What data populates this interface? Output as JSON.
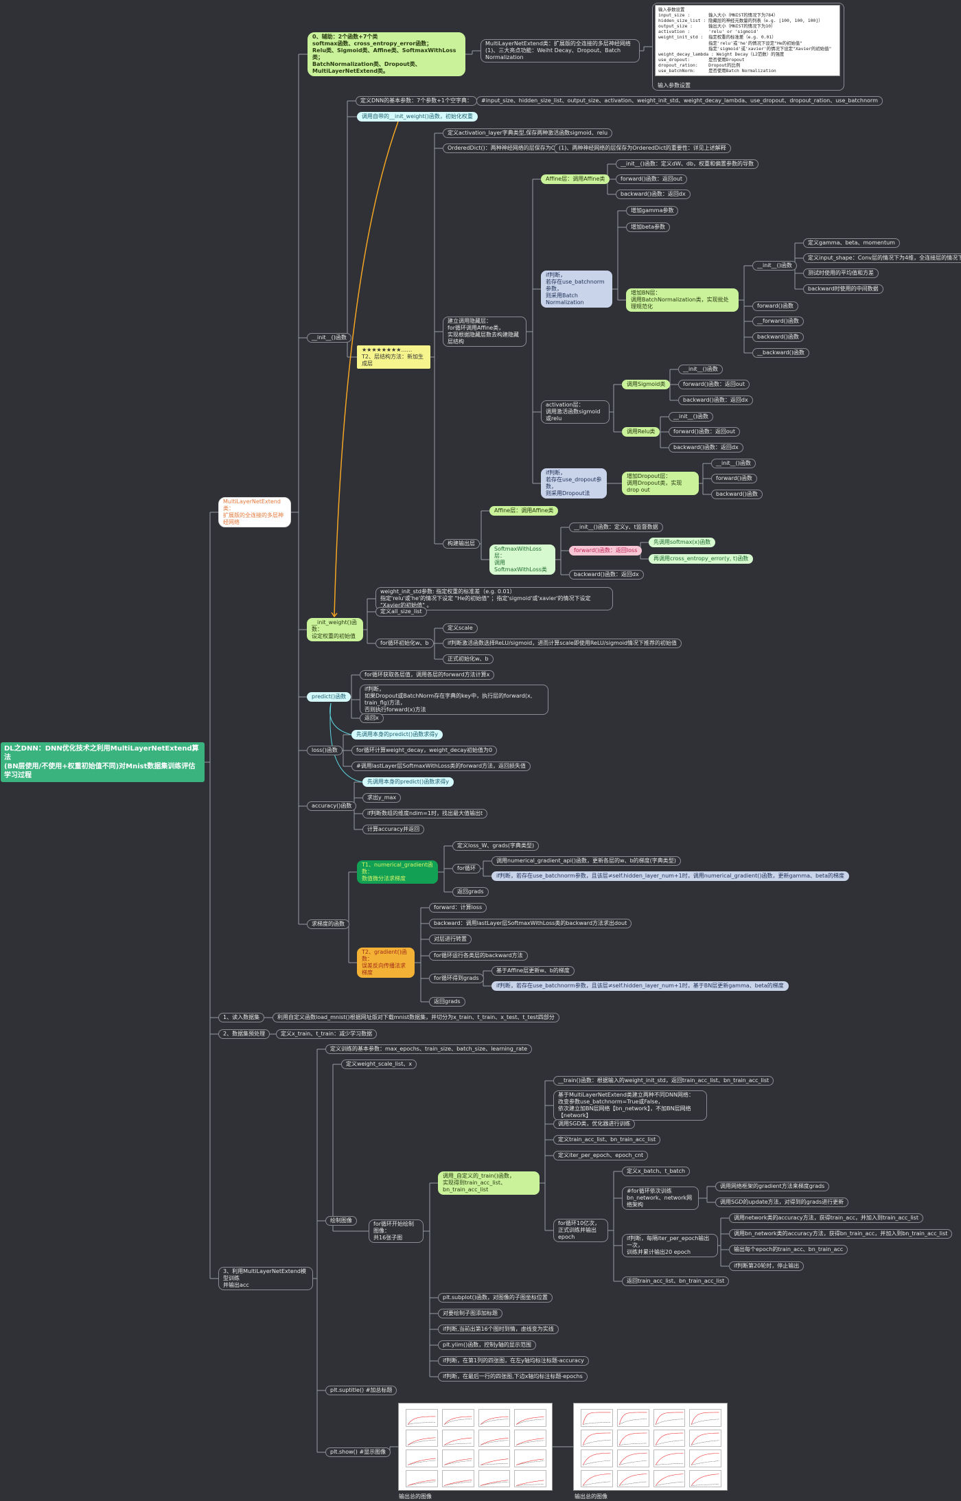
{
  "root": "DL之DNN：DNN优化技术之利用MultiLayerNetExtend算法\n(BN层使用/不使用+权重初始值不同)对Mnist数据集训练评估学习过程",
  "aux": {
    "label": "0、辅助：2个函数+7个类\nsoftmax函数、cross_entropy_error函数；\nRelu类、Sigmoid类、Affine类、SoftmaxWithLoss类；\nBatchNormalization类、Dropout类、MultiLayerNetExtend类。",
    "child": "MultiLayerNetExtend类：扩展版的全连接的多层神经网络\n(1)、三大亮点功能：Weiht Decay、Dropout、Batch Normalization",
    "params_caption": "输入参数设置",
    "params_lines": [
      "输入参数设置",
      "input_size :       输入大小（MNIST的情况下为784）",
      "hidden_size_list : 隐藏层的神经元数量的列表（e.g. [100, 100, 100]）",
      "output_size :      输出大小（MNIST的情况下为10）",
      "activation :       'relu' or 'sigmoid'",
      "weight_init_std :  指定权重的标准差（e.g. 0.01）",
      "                   指定'relu'或'he'的情况下设定\"He的初始值\"",
      "                   指定'sigmoid'或'xavier'的情况下设定\"Xavier的初始值\"",
      "weight_decay_lambda : Weight Decay（L2范数）的强度",
      "use_dropout:       是否使用Dropout",
      "dropout_ration:    Dropout的比例",
      "use_batchNorm:     是否使用Batch Normalization"
    ]
  },
  "mlp": "MultiLayerNetExtend类：\n扩展版的全连接的多层神经网络",
  "init": {
    "label": "__init__()函数",
    "define": "定义DNN的基本参数：7个参数+1个空字典：",
    "define_child": "#input_size、hidden_size_list、output_size、activation、weight_init_std、weight_decay_lambda、use_dropout、dropout_ration、use_batchnorm",
    "call_init_weight": "调用自带的__init_weight()函数，初始化权重",
    "star": "★★★★★★★★……\nT2、层结构方法：新加生成层",
    "act_dict": "定义activation_layer字典类型,保存两种激活函数sigmoid、relu",
    "ordered": "OrderedDict()：两种神经网络的层保存为OrderedDict",
    "ordered_child": "(1)、两种神经网络的层保存为OrderedDict的重要性：详见上述解释",
    "build_hidden": "建立调用隐藏层：\nfor循环调用Affine类，\n实现根据隐藏层数去构建隐藏层结构",
    "affine_layer": "Affine层：调用Affine类",
    "affine_children": [
      "__init__()函数：定义dW、db，权重和偏置参数的导数",
      "forward()函数：返回out",
      "backward()函数：返回dx"
    ],
    "bn_judge": "if判断，\n若存在use_batchnorm参数，\n则采用Batch Normalization",
    "gamma": "增加gamma参数",
    "beta": "增加beta参数",
    "bn_layer": "增加BN层：\n调用BatchNormalization类，实现批处理规范化",
    "bn_init": "__init__()函数",
    "bn_init_children": [
      "定义gamma、beta、momentum",
      "定义input_shape：Conv层的情况下为4维，全连接层的情况下为2维",
      "测试时使用的平均值和方差",
      "backward时使用的中间数据"
    ],
    "bn_methods": [
      "forward()函数",
      "__forward()函数",
      "backward()函数",
      "__backward()函数"
    ],
    "act_layer": "activation层：\n调用激活函数sigmoid或relu",
    "sigmoid": "调用Sigmoid类",
    "sigmoid_children": [
      "__init__()函数",
      "forward()函数：返回out",
      "backward()函数：返回dx"
    ],
    "relu": "调用Relu类",
    "relu_children": [
      "__init__()函数",
      "forward()函数：返回out",
      "backward()函数：返回dx"
    ],
    "dropout_judge": "if判断，\n若存在use_dropout参数，\n则采用Dropout法",
    "dropout_layer": "增加Dropout层：\n调用Dropout类，实现drop out",
    "dropout_children": [
      "__init__()函数",
      "forward()函数",
      "backward()函数"
    ],
    "build_output": "构建输出层",
    "out_affine": "Affine层：调用Affine类",
    "softmax_layer": "SoftmaxWithLoss层：\n调用SoftmaxWithLoss类",
    "softmax_init": "__init__()函数：定义y、t监督数据",
    "softmax_forward": "forward()函数：返回loss",
    "softmax_forward_children": [
      "先调用softmax(x)函数",
      "再调用cross_entropy_error(y, t)函数"
    ],
    "softmax_backward": "backward()函数：返回dx"
  },
  "init_weight": {
    "label": "__init_weight()函数：\n设定权重的初始值",
    "std": "weight_init_std参数: 指定权重的标准差（e.g. 0.01）\n指定'relu'或'he'的情况下设定  \"He的初始值\"  ；指定'sigmoid'或'xavier'的情况下设定   \"Xavier的初始值\"  。",
    "all_size": "定义all_size_list",
    "for_init": "for循环初始化w、b",
    "scale": "定义scale",
    "scale_if": "if判断激活函数选择ReLU/sigmoid，进而计算scale即使用ReLU/sigmoid情况下推荐的初始值",
    "formal": "正式初始化w、b"
  },
  "predict": {
    "label": "predict()函数",
    "children": [
      "for循环获取各层值，调用各层的forward方法计算x",
      "if判断，\n如果Dropout或BatchNorm存在字典的key中，执行层的forward(x, train_flg)方法，\n否则执行forward(x)方法",
      "返回x"
    ]
  },
  "loss": {
    "label": "loss()函数",
    "children": [
      "先调用本身的predict()函数求得y",
      "for循环计算weight_decay，weight_decay初始值为0",
      "#调用lastLayer层SoftmaxWithLoss类的forward方法，返回损失值"
    ]
  },
  "accuracy": {
    "label": "accuracy()函数",
    "children": [
      "先调用本身的predict()函数求得y",
      "求出y_max",
      "if判断数组的维度ndim=1时，找出最大值输出t",
      "计算accuracy并返回"
    ]
  },
  "gradient": {
    "label": "求梯度的函数",
    "t1": "T1、numerical_gradient函数：\n数值微分法求梯度",
    "t1_children": [
      "定义loss_W、grads(字典类型)",
      "for循环",
      "返回grads"
    ],
    "t1_for": [
      "调用numerical_gradient_api()函数，更新各层的w、b的梯度(字典类型)",
      "if判断，若存在use_batchnorm参数，且该层≠self.hidden_layer_num+1时，调用numerical_gradient()函数，更新gamma、beta的梯度"
    ],
    "t2": "T2、gradient()函数：\n误差反向传播法求梯度",
    "t2_children": [
      "forward：计算loss",
      "backward：调用lastLayer层SoftmaxWithLoss类的backward方法求出dout",
      "对层进行转置",
      "for循环运行各类层的backward方法",
      "for循环得到grads",
      "返回grads"
    ],
    "t2_for": [
      "基于Affine层更新w、b的梯度",
      "if判断，若存在use_batchnorm参数，且该层≠self.hidden_layer_num+1时，基于BN层更新gamma、beta的梯度"
    ]
  },
  "step1": {
    "label": "1、读入数据集",
    "child": "利用自定义函数load_mnist()根据网址版对下载mnist数据集，并切分为x_train、t_train、x_test、t_test四部分"
  },
  "step2": {
    "label": "2、数据集预处理",
    "child": "定义x_train、t_train：减少学习数据"
  },
  "step3": {
    "label": "3、利用MultiLayerNetExtend模型训练\n并输出acc",
    "define": "定义训练的基本参数：max_epochs、train_size、batch_size、learning_rate",
    "draw": "绘制图像",
    "weight_scale": "定义weight_scale_list、x",
    "for16": "for循环开始绘制图像：\n共16张子图",
    "call_train": "调用_自定义的_train()函数，\n实现得到train_acc_list、bn_train_acc_list",
    "train_children": [
      "__train()函数：根据输入的weight_init_std，返回train_acc_list、bn_train_acc_list",
      "基于MultiLayerNetExtend类建立两种不同DNN网络：\n改变参数use_batchnorm=True或False，\n依次建立加BN层网络【bn_network】，不加BN层网络【network】",
      "调用SGD类，优化器进行训练",
      "定义train_acc_list、bn_train_acc_list",
      "定义iter_per_epoch、epoch_cnt"
    ],
    "for10": "for循环10亿次，\n正式训练并输出epoch",
    "for10_children": [
      "定义x_batch、t_batch",
      "#for循环依次训练\nbn_network、network网络架构",
      "if判断，每隔iter_per_epoch输出一次，\n训练并累计输出20 epoch",
      "返回train_acc_list、bn_train_acc_list"
    ],
    "nets_children": [
      "调用网络框架的gradient方法来梯度grads",
      "调用SGD的update方法，对得到的grads进行更新"
    ],
    "epoch_children": [
      "调用network类的accuracy方法，获得train_acc，并加入到train_acc_list",
      "调用bn_network类的accuracy方法，获得bn_train_acc，并加入到bn_train_acc_list",
      "输出每个epoch的train_acc、bn_train_acc",
      "if判断第20轮时，停止输出"
    ],
    "plot_children": [
      "plt.subplot()函数，对图像的子图坐标位置",
      "对要绘制子图添加标题",
      "if判断,当前出第16个图时到情，虚线变为实线",
      "plt.ylim()函数，控制y轴的显示范围",
      "if判断，在第1列的四张图，在左y轴均标注标题-accuracy",
      "if判断，在最后一行的四张图,下边x轴均标注标题-epochs"
    ],
    "suptitle": "plt.suptitle() #加总标题",
    "show": "plt.show() #显示图像",
    "out1": "输出总的图像",
    "out2": "输出总的图像"
  },
  "colors": {
    "background": "#2f3136",
    "line": "#9aa0a6",
    "arrow": "#f5a623",
    "root": "#3bb37f"
  }
}
